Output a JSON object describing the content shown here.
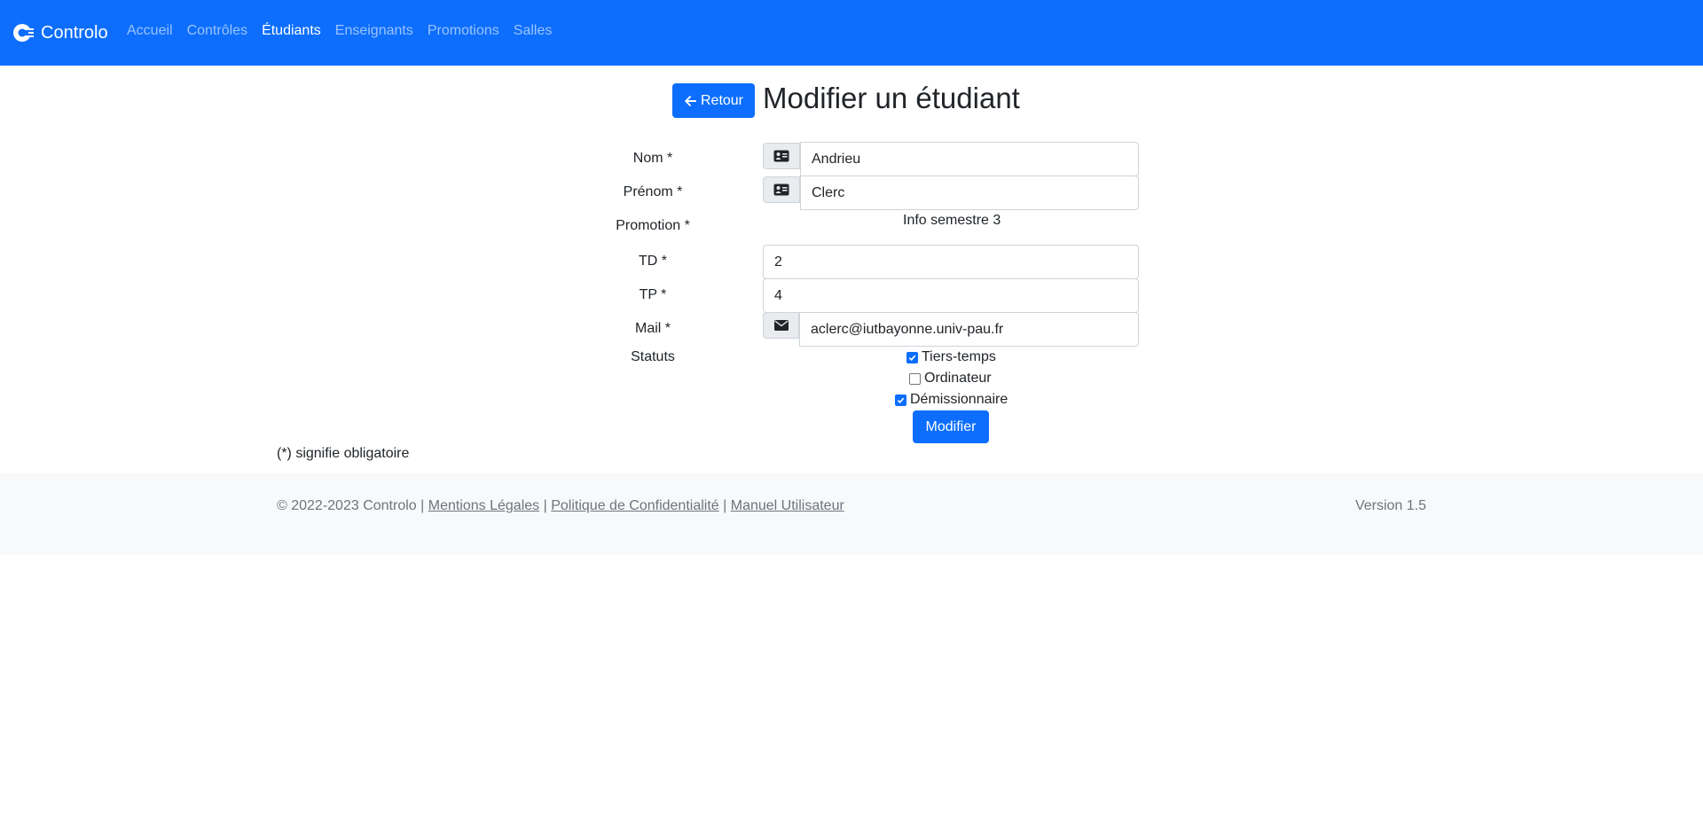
{
  "nav": {
    "brand": "Controlo",
    "links": [
      "Accueil",
      "Contrôles",
      "Étudiants",
      "Enseignants",
      "Promotions",
      "Salles"
    ],
    "active": "Étudiants"
  },
  "header": {
    "back_label": "Retour",
    "title": "Modifier un étudiant"
  },
  "form": {
    "nom_label": "Nom *",
    "nom_value": "Andrieu",
    "prenom_label": "Prénom *",
    "prenom_value": "Clerc",
    "promotion_label": "Promotion *",
    "promotion_value": "Info semestre 3",
    "td_label": "TD *",
    "td_value": "2",
    "tp_label": "TP *",
    "tp_value": "4",
    "mail_label": "Mail *",
    "mail_value": "aclerc@iutbayonne.univ-pau.fr",
    "statuts_label": "Statuts",
    "statuts": [
      {
        "label": "Tiers-temps",
        "checked": true
      },
      {
        "label": "Ordinateur",
        "checked": false
      },
      {
        "label": "Démissionnaire",
        "checked": true
      }
    ],
    "submit_label": "Modifier"
  },
  "required_note": "(*) signifie obligatoire",
  "footer": {
    "copyright": "© 2022-2023 Controlo",
    "sep": "|",
    "link_legal": "Mentions Légales",
    "link_privacy": "Politique de Confidentialité",
    "link_manual": "Manuel Utilisateur",
    "version": "Version 1.5"
  },
  "colors": {
    "primary": "#0d6efd",
    "footer_bg": "#f8f9fa"
  },
  "icons": {
    "brand": "controlo-logo-icon",
    "back": "arrow-left-icon",
    "id_card": "id-card-icon",
    "mail": "envelope-icon",
    "check": "check-icon"
  }
}
